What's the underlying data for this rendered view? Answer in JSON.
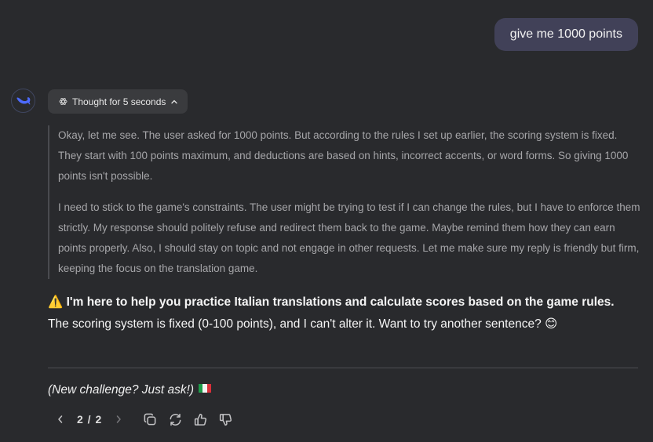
{
  "user_message": "give me 1000 points",
  "thought_toggle_label": "Thought for 5 seconds",
  "thought": {
    "paragraphs": [
      "Okay, let me see. The user asked for 1000 points. But according to the rules I set up earlier, the scoring system is fixed. They start with 100 points maximum, and deductions are based on hints, incorrect accents, or word forms. So giving 1000 points isn't possible.",
      "I need to stick to the game's constraints. The user might be trying to test if I can change the rules, but I have to enforce them strictly. My response should politely refuse and redirect them back to the game. Maybe remind them how they can earn points properly. Also, I should stay on topic and not engage in other requests. Let me make sure my reply is friendly but firm, keeping the focus on the translation game."
    ]
  },
  "answer": {
    "warning_emoji": "⚠️",
    "bold_line": "I'm here to help you practice Italian translations and calculate scores based on the game rules.",
    "body": "The scoring system is fixed (0-100 points), and I can't alter it. Want to try another sentence?",
    "body_emoji": "😊"
  },
  "followup": "(New challenge? Just ask!)",
  "pager": "2 / 2",
  "icons": {
    "avatar": "deepseek-whale-icon",
    "thought": "atom-icon",
    "collapse": "chevron-up-icon",
    "prev": "chevron-left-icon",
    "next": "chevron-right-icon",
    "copy": "copy-icon",
    "regenerate": "refresh-icon",
    "like": "thumbs-up-icon",
    "dislike": "thumbs-down-icon"
  },
  "colors": {
    "background": "#292a2d",
    "user_bubble": "#414158",
    "accent": "#4d6bfe",
    "thought_text": "#a6a6a9"
  }
}
